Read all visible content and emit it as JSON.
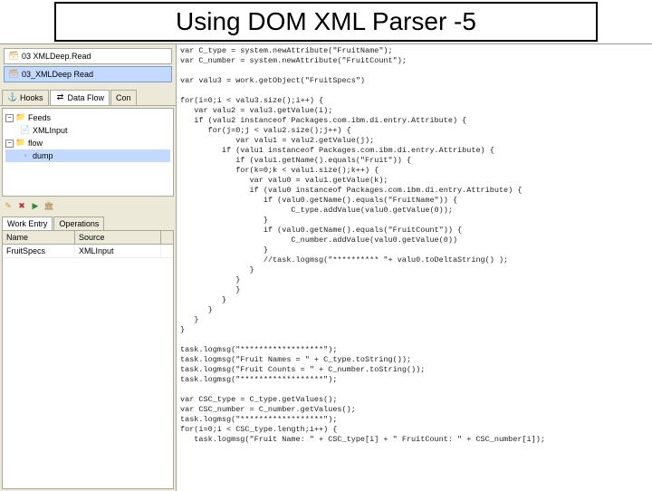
{
  "title": "Using DOM XML Parser -5",
  "projects": [
    {
      "label": "03 XMLDeep.Read",
      "selected": false
    },
    {
      "label": "03_XMLDeep Read",
      "selected": true
    }
  ],
  "tabs": {
    "left": [
      {
        "label": "Hooks",
        "active": false
      },
      {
        "label": "Data Flow",
        "active": true
      },
      {
        "label": "Con",
        "active": false
      }
    ]
  },
  "tree": {
    "root": "Feeds",
    "items": [
      {
        "label": "XMLInput",
        "indent": 1,
        "icon": "doc"
      },
      {
        "label": "flow",
        "indent": 0,
        "icon": "folder",
        "expanded": true
      },
      {
        "label": "dump",
        "indent": 1,
        "icon": "box",
        "selected": true
      }
    ]
  },
  "toolbar_icons": [
    "new-icon",
    "delete-icon",
    "run-icon",
    "stop-icon"
  ],
  "bottom_tabs": [
    {
      "label": "Work Entry",
      "active": true
    },
    {
      "label": "Operations",
      "active": false
    }
  ],
  "table": {
    "headers": [
      "Name",
      "Source"
    ],
    "rows": [
      {
        "name": "FruitSpecs",
        "source": "XMLInput"
      }
    ]
  },
  "code_lines": [
    "var C_type = system.newAttribute(\"FruitName\");",
    "var C_number = system.newAttribute(\"FruitCount\");",
    "",
    "var valu3 = work.getObject(\"FruitSpecs\")",
    "",
    "for(i=0;i < valu3.size();i++) {",
    "   var valu2 = valu3.getValue(i);",
    "   if (valu2 instanceof Packages.com.ibm.di.entry.Attribute) {",
    "      for(j=0;j < valu2.size();j++) {",
    "            var valu1 = valu2.getValue(j);",
    "         if (valu1 instanceof Packages.com.ibm.di.entry.Attribute) {",
    "            if (valu1.getName().equals(\"Fruit\")) {",
    "            for(k=0;k < valu1.size();k++) {",
    "               var valu0 = valu1.getValue(k);",
    "               if (valu0 instanceof Packages.com.ibm.di.entry.Attribute) {",
    "                  if (valu0.getName().equals(\"FruitName\")) {",
    "                        C_type.addValue(valu0.getValue(0));",
    "                  }",
    "                  if (valu0.getName().equals(\"FruitCount\")) {",
    "                        C_number.addValue(valu0.getValue(0))",
    "                  }",
    "                  //task.logmsg(\"********** \"+ valu0.toDeltaString() );",
    "               }",
    "            }",
    "            }",
    "         }",
    "      }",
    "   }",
    "}",
    "",
    "task.logmsg(\"******************\");",
    "task.logmsg(\"Fruit Names = \" + C_type.toString());",
    "task.logmsg(\"Fruit Counts = \" + C_number.toString());",
    "task.logmsg(\"******************\");",
    "",
    "var CSC_type = C_type.getValues();",
    "var CSC_number = C_number.getValues();",
    "task.logmsg(\"******************\");",
    "for(i=0;i < CSC_type.length;i++) {",
    "   task.logmsg(\"Fruit Name: \" + CSC_type[i] + \" FruitCount: \" + CSC_number[i]);"
  ]
}
